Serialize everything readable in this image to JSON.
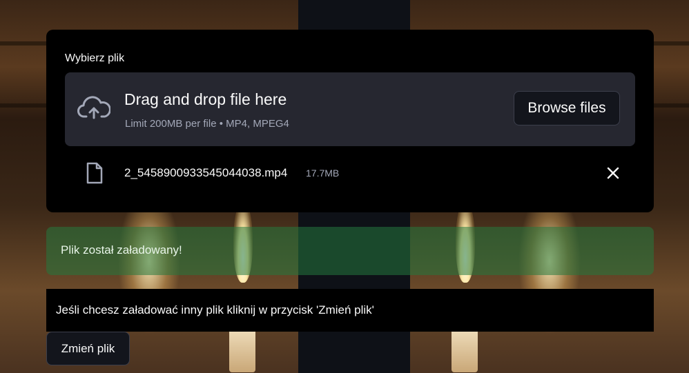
{
  "uploader": {
    "label": "Wybierz plik",
    "dropzone_title": "Drag and drop file here",
    "dropzone_subtitle": "Limit 200MB per file • MP4, MPEG4",
    "browse_label": "Browse files",
    "icon": "cloud-upload-icon"
  },
  "file": {
    "name": "2_5458900933545044038.mp4",
    "size": "17.7MB",
    "icon": "file-icon",
    "remove_icon": "close-icon"
  },
  "alert": {
    "message": "Plik został załadowany!"
  },
  "info": {
    "text": "Jeśli chcesz załadować inny plik kliknij w przycisk 'Zmień plik'"
  },
  "change_button": {
    "label": "Zmień plik"
  },
  "colors": {
    "card_background": "#000000",
    "dropzone_background": "#262730",
    "success_background": "#24783e",
    "text": "#fafafa",
    "muted_text": "#a3a8b8"
  }
}
